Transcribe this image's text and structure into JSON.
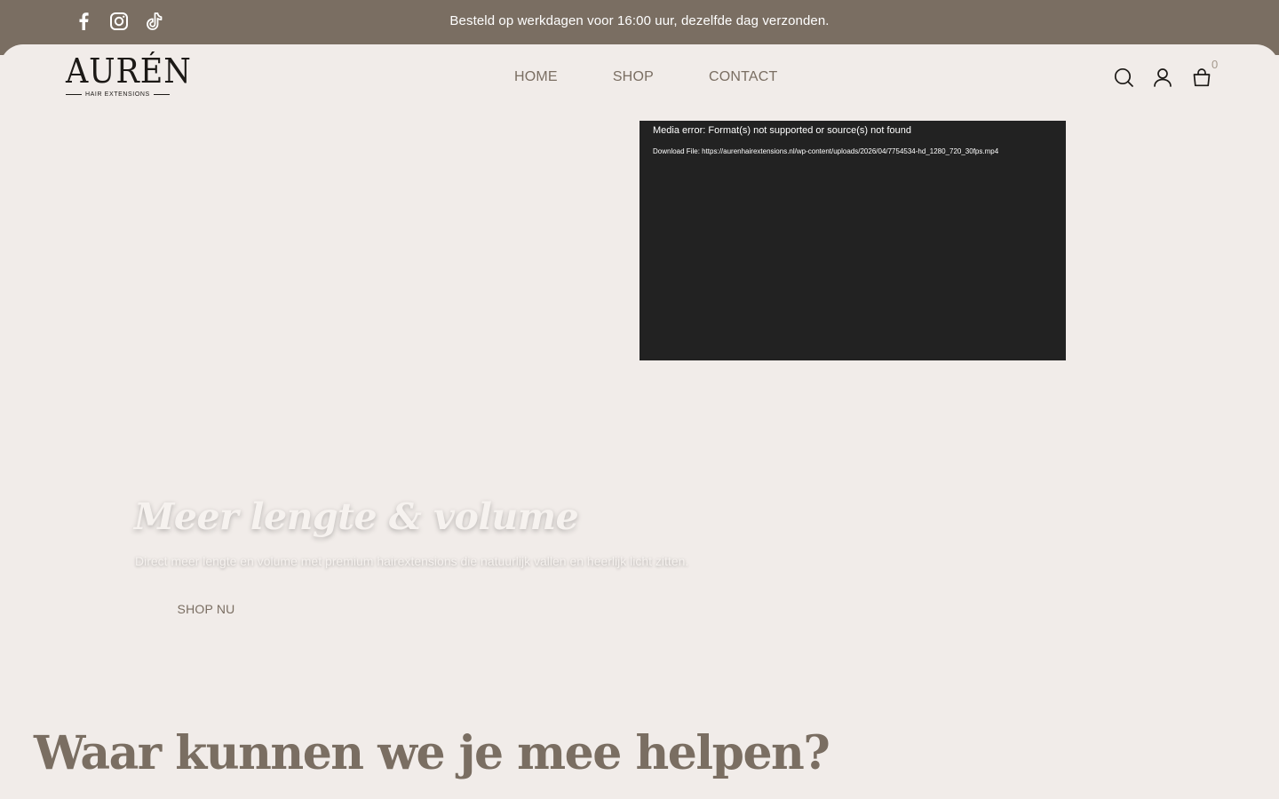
{
  "colors": {
    "brand": "#7a6e62",
    "background": "#f1ece9",
    "video_bg": "#222222"
  },
  "topbar": {
    "socials": [
      {
        "name": "facebook-icon"
      },
      {
        "name": "instagram-icon"
      },
      {
        "name": "tiktok-icon"
      }
    ],
    "announcement": "Besteld op werkdagen voor 16:00 uur, dezelfde dag verzonden."
  },
  "header": {
    "logo": {
      "wordmark": "AURÉN",
      "subtitle": "HAIR EXTENSIONS"
    },
    "nav": [
      {
        "label": "HOME"
      },
      {
        "label": "SHOP"
      },
      {
        "label": "CONTACT"
      }
    ],
    "icons": [
      "search-icon",
      "account-icon",
      "cart-icon"
    ],
    "cart_count": "0"
  },
  "video": {
    "error": "Media error: Format(s) not supported or source(s) not found",
    "download": "Download File: https://aurenhairextensions.nl/wp-content/uploads/2026/04/7754534-hd_1280_720_30fps.mp4"
  },
  "hero": {
    "title": "Meer lengte & volume",
    "subtitle": "Direct meer lengte en volume met premium hairextensions die natuurlijk vallen en heerlijk licht zitten.",
    "button": "SHOP NU"
  },
  "section": {
    "title": "Waar kunnen we je mee helpen?"
  }
}
